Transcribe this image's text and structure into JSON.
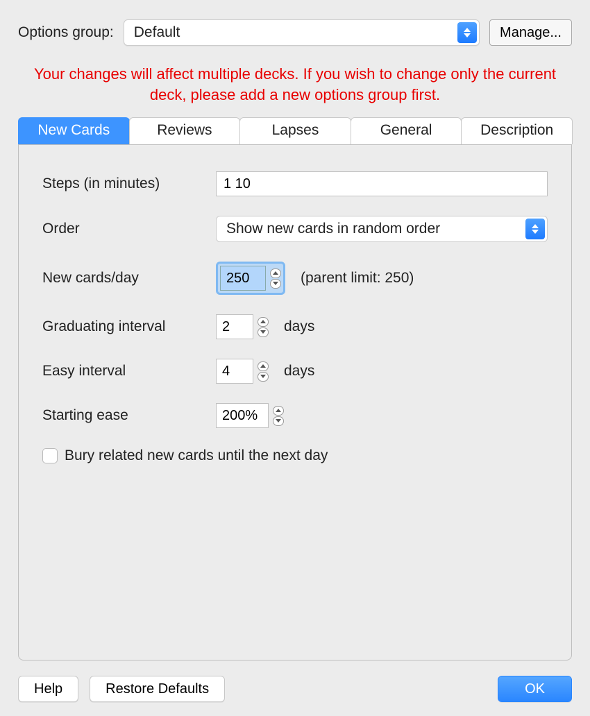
{
  "header": {
    "options_group_label": "Options group:",
    "options_group_value": "Default",
    "manage_label": "Manage..."
  },
  "warning_text": "Your changes will affect multiple decks. If you wish to change only the current deck, please add a new options group first.",
  "tabs": {
    "new_cards": "New Cards",
    "reviews": "Reviews",
    "lapses": "Lapses",
    "general": "General",
    "description": "Description",
    "active": "new_cards"
  },
  "form": {
    "steps_label": "Steps (in minutes)",
    "steps_value": "1 10",
    "order_label": "Order",
    "order_value": "Show new cards in random order",
    "new_per_day_label": "New cards/day",
    "new_per_day_value": "250",
    "parent_limit_text": "(parent limit: 250)",
    "grad_interval_label": "Graduating interval",
    "grad_interval_value": "2",
    "easy_interval_label": "Easy interval",
    "easy_interval_value": "4",
    "days_suffix": "days",
    "starting_ease_label": "Starting ease",
    "starting_ease_value": "200%",
    "bury_label": "Bury related new cards until the next day",
    "bury_checked": false
  },
  "footer": {
    "help_label": "Help",
    "restore_label": "Restore Defaults",
    "ok_label": "OK"
  }
}
